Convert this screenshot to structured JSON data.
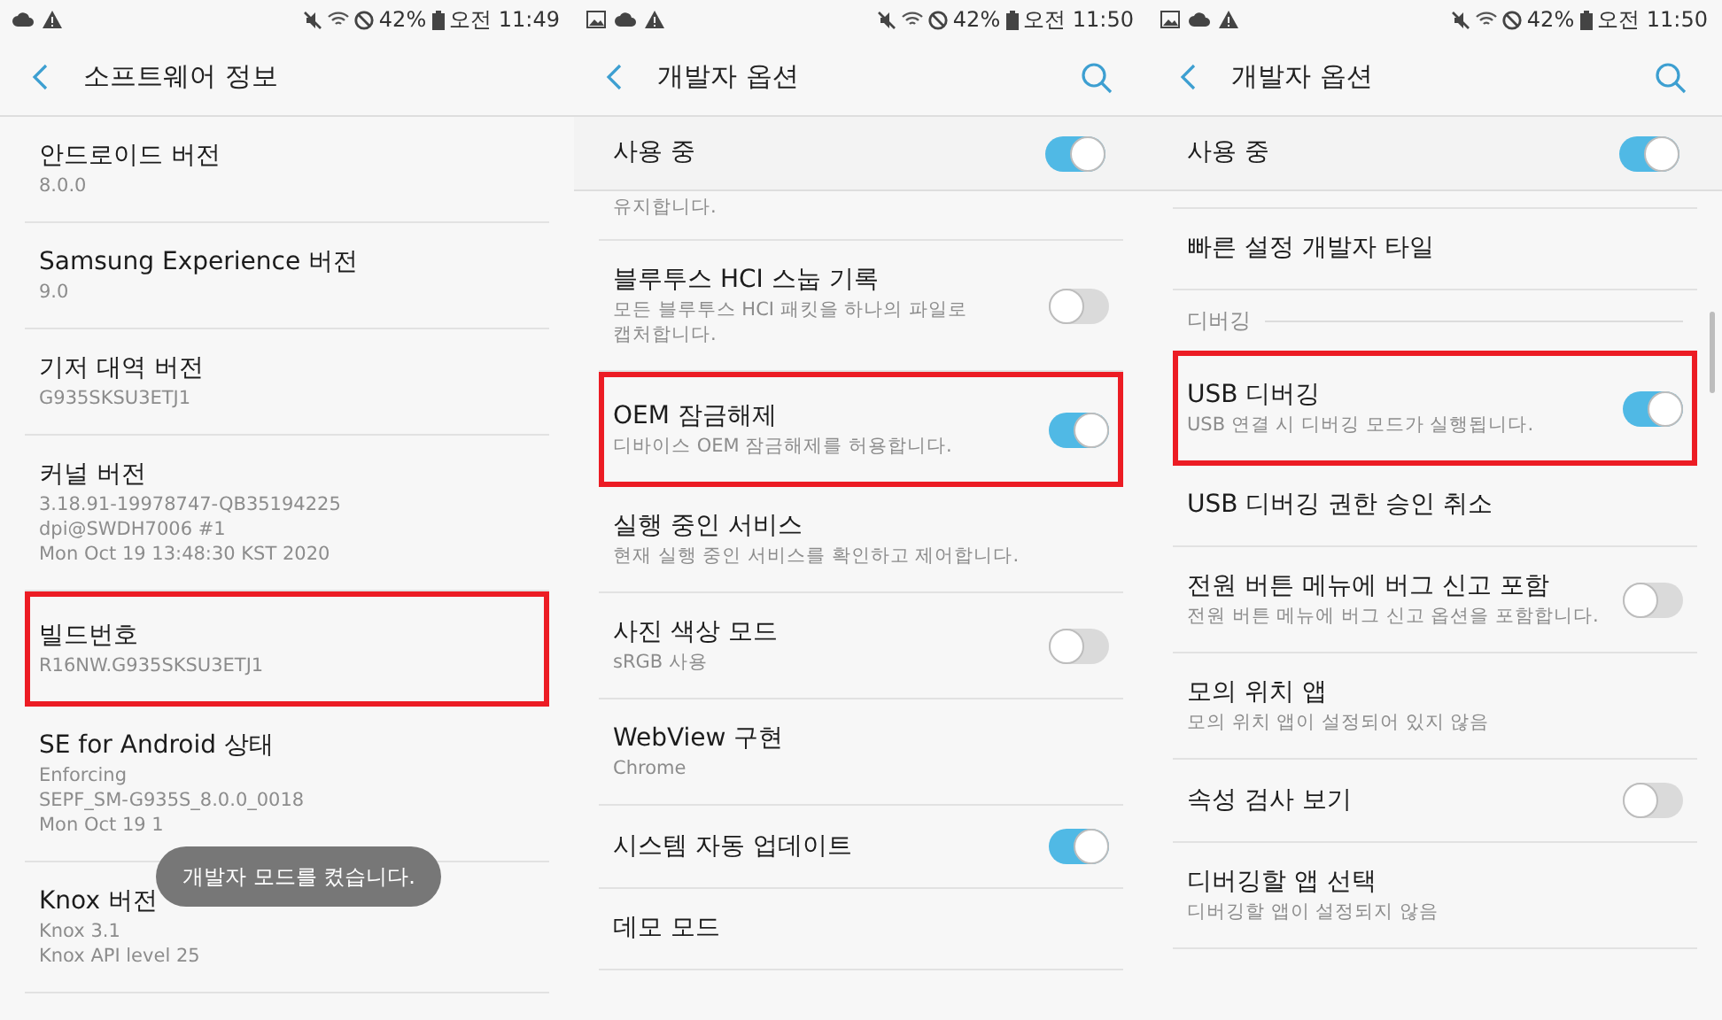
{
  "screens": [
    {
      "status_bar": {
        "notification_icons": [
          {
            "kind": "cloud"
          },
          {
            "kind": "warning"
          }
        ],
        "battery": "42%",
        "time": "오전 11:49"
      },
      "header": {
        "title": "소프트웨어 정보",
        "search": false
      },
      "items": [
        {
          "kind": "info",
          "title": "안드로이드 버전",
          "lines": [
            "8.0.0"
          ],
          "highlighted": false
        },
        {
          "kind": "info",
          "title": "Samsung Experience 버전",
          "lines": [
            "9.0"
          ],
          "highlighted": false
        },
        {
          "kind": "info",
          "title": "기저 대역 버전",
          "lines": [
            "G935SKSU3ETJ1"
          ],
          "highlighted": false
        },
        {
          "kind": "info",
          "title": "커널 버전",
          "lines": [
            "3.18.91-19978747-QB35194225",
            "dpi@SWDH7006 #1",
            "Mon Oct 19 13:48:30 KST 2020"
          ],
          "highlighted": false
        },
        {
          "kind": "info",
          "title": "빌드번호",
          "lines": [
            "R16NW.G935SKSU3ETJ1"
          ],
          "highlighted": true
        },
        {
          "kind": "info",
          "title": "SE for Android 상태",
          "lines": [
            "Enforcing",
            "SEPF_SM-G935S_8.0.0_0018",
            "Mon Oct 19 1"
          ],
          "highlighted": false
        },
        {
          "kind": "info",
          "title": "Knox 버전",
          "lines": [
            "Knox 3.1",
            "Knox API level 25"
          ],
          "highlighted": false
        }
      ],
      "toast": {
        "text": "개발자 모드를 켰습니다."
      }
    },
    {
      "status_bar": {
        "notification_icons": [
          {
            "kind": "image"
          },
          {
            "kind": "cloud"
          },
          {
            "kind": "warning"
          }
        ],
        "battery": "42%",
        "time": "오전 11:50"
      },
      "header": {
        "title": "개발자 옵션",
        "search": true
      },
      "pinned": {
        "title": "사용 중",
        "on": true
      },
      "items": [
        {
          "kind": "tail",
          "lines": [
            "유지합니다."
          ],
          "highlighted": false
        },
        {
          "kind": "toggle",
          "title": "블루투스 HCI 스눕 기록",
          "lines": [
            "모든 블루투스 HCI 패킷을 하나의 파일로",
            "캡처합니다."
          ],
          "on": false,
          "highlighted": false
        },
        {
          "kind": "toggle",
          "title": "OEM 잠금해제",
          "lines": [
            "디바이스 OEM 잠금해제를 허용합니다."
          ],
          "on": true,
          "highlighted": true
        },
        {
          "kind": "info",
          "title": "실행 중인 서비스",
          "lines": [
            "현재 실행 중인 서비스를 확인하고 제어합니다."
          ],
          "highlighted": false
        },
        {
          "kind": "toggle",
          "title": "사진 색상 모드",
          "lines": [
            "sRGB 사용"
          ],
          "on": false,
          "highlighted": false
        },
        {
          "kind": "info",
          "title": "WebView 구현",
          "lines": [
            "Chrome"
          ],
          "highlighted": false
        },
        {
          "kind": "toggle",
          "title": "시스템 자동 업데이트",
          "on": true,
          "highlighted": false
        },
        {
          "kind": "info",
          "title": "데모 모드",
          "highlighted": false
        }
      ]
    },
    {
      "status_bar": {
        "notification_icons": [
          {
            "kind": "image"
          },
          {
            "kind": "cloud"
          },
          {
            "kind": "warning"
          }
        ],
        "battery": "42%",
        "time": "오전 11:50"
      },
      "header": {
        "title": "개발자 옵션",
        "search": true
      },
      "pinned": {
        "title": "사용 중",
        "on": true
      },
      "items": [
        {
          "kind": "spacer"
        },
        {
          "kind": "info",
          "title": "빠른 설정 개발자 타일",
          "highlighted": false
        },
        {
          "kind": "category",
          "title": "디버깅"
        },
        {
          "kind": "toggle",
          "title": "USB 디버깅",
          "lines": [
            "USB 연결 시 디버깅 모드가 실행됩니다."
          ],
          "on": true,
          "highlighted": true
        },
        {
          "kind": "info",
          "title": "USB 디버깅 권한 승인 취소",
          "highlighted": false
        },
        {
          "kind": "toggle",
          "title": "전원 버튼 메뉴에 버그 신고 포함",
          "lines": [
            "전원 버튼 메뉴에 버그 신고 옵션을 포함합니다."
          ],
          "on": false,
          "highlighted": false
        },
        {
          "kind": "info",
          "title": "모의 위치 앱",
          "lines": [
            "모의 위치 앱이 설정되어 있지 않음"
          ],
          "highlighted": false
        },
        {
          "kind": "toggle",
          "title": "속성 검사 보기",
          "on": false,
          "highlighted": false
        },
        {
          "kind": "info",
          "title": "디버깅할 앱 선택",
          "lines": [
            "디버깅할 앱이 설정되지 않음"
          ],
          "highlighted": false
        }
      ]
    }
  ]
}
